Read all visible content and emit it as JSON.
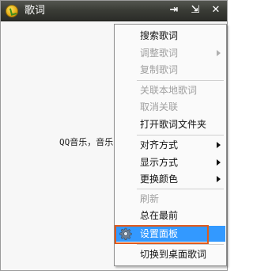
{
  "window": {
    "title": "歌词",
    "buttons": {
      "pin": "⇥",
      "minimize": "⇲",
      "close": "✕"
    }
  },
  "lyric": {
    "text": "QQ音乐，音乐"
  },
  "menu": {
    "items": [
      {
        "label": "搜索歌词",
        "enabled": true,
        "submenu": false
      },
      {
        "label": "调整歌词",
        "enabled": false,
        "submenu": true
      },
      {
        "label": "复制歌词",
        "enabled": false,
        "submenu": false
      },
      {
        "label": "关联本地歌词",
        "enabled": false,
        "submenu": false
      },
      {
        "label": "取消关联",
        "enabled": false,
        "submenu": false
      },
      {
        "label": "打开歌词文件夹",
        "enabled": true,
        "submenu": false
      },
      {
        "label": "对齐方式",
        "enabled": true,
        "submenu": true
      },
      {
        "label": "显示方式",
        "enabled": true,
        "submenu": true
      },
      {
        "label": "更换颜色",
        "enabled": true,
        "submenu": true
      },
      {
        "label": "刷新",
        "enabled": false,
        "submenu": false
      },
      {
        "label": "总在最前",
        "enabled": true,
        "submenu": false
      },
      {
        "label": "设置面板",
        "enabled": true,
        "submenu": false,
        "highlighted": true,
        "icon": "gear-icon"
      },
      {
        "label": "切换到桌面歌词",
        "enabled": true,
        "submenu": false
      }
    ]
  },
  "colors": {
    "highlight": "#3399ff",
    "callout": "#e05a1c",
    "titlebar": "#3b3d37"
  }
}
